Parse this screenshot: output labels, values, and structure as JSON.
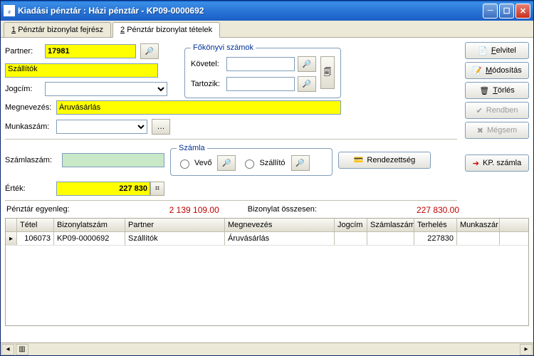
{
  "window": {
    "title": "Kiadási pénztár : Házi pénztár - KP09-0000692"
  },
  "tabs": [
    {
      "n": "1",
      "label": "Pénztár bizonylat fejrész"
    },
    {
      "n": "2",
      "label": "Pénztár bizonylat tételek"
    }
  ],
  "active_tab": 1,
  "form": {
    "partner_lbl": "Partner:",
    "partner_val": "17981",
    "partner_name": "Szállítók",
    "jogcim_lbl": "Jogcím:",
    "jogcim_val": "",
    "megnev_lbl": "Megnevezés:",
    "megnev_val": "Áruvásárlás",
    "munkaszam_lbl": "Munkaszám:",
    "munkaszam_val": ""
  },
  "ledger": {
    "legend": "Főkönyvi számok",
    "kovetel_lbl": "Követel:",
    "kovetel_val": "",
    "tartozik_lbl": "Tartozik:",
    "tartozik_val": ""
  },
  "invoice": {
    "szamlaszam_lbl": "Számlaszám:",
    "szamlaszam_val": "",
    "legend": "Számla",
    "vevo": "Vevő",
    "szallito": "Szállító",
    "rendezettseg": "Rendezettség"
  },
  "ertek": {
    "lbl": "Érték:",
    "val": "227 830"
  },
  "totals": {
    "penztar_lbl": "Pénztár egyenleg:",
    "penztar_val": "2 139 109.00",
    "bizonylat_lbl": "Bizonylat összesen:",
    "bizonylat_val": "227 830.00"
  },
  "grid": {
    "cols": [
      "Tétel",
      "Bizonylatszám",
      "Partner",
      "Megnevezés",
      "Jogcím",
      "Számlaszám",
      "Terhelés",
      "Munkaszár"
    ],
    "widths": [
      52,
      100,
      140,
      154,
      46,
      66,
      60,
      60
    ],
    "rows": [
      {
        "tetel": "106073",
        "biz": "KP09-0000692",
        "partner": "Szállítók",
        "megnev": "Áruvásárlás",
        "jogcim": "",
        "szamlaszam": "",
        "terheles": "227830",
        "munkaszam": ""
      }
    ]
  },
  "buttons": {
    "felvitel": "Felvitel",
    "modositas": "Módosítás",
    "torles": "Törlés",
    "rendben": "Rendben",
    "megsem": "Mégsem",
    "kpszamla": "KP. számla"
  }
}
